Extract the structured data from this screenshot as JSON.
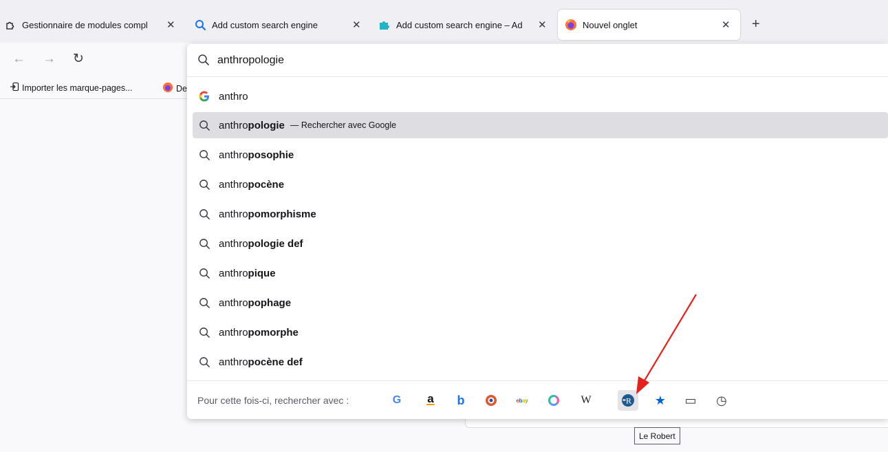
{
  "tabs": [
    {
      "title": "Gestionnaire de modules compl",
      "icon": "puzzle-outline-icon",
      "close": "✕"
    },
    {
      "title": "Add custom search engine",
      "icon": "search-icon",
      "close": "✕"
    },
    {
      "title": "Add custom search engine – Ad",
      "icon": "puzzle-blue-icon",
      "close": "✕"
    },
    {
      "title": "Nouvel onglet",
      "icon": "firefox-icon",
      "close": "✕",
      "active": true
    }
  ],
  "new_tab_label": "+",
  "nav": {
    "back": "←",
    "forward": "→",
    "reload": "↻"
  },
  "bookmarks": [
    {
      "label": "Importer les marque-pages...",
      "icon": "import-icon"
    },
    {
      "label": "De",
      "icon": "firefox-icon"
    }
  ],
  "urlbar": {
    "value": "anthropologie",
    "first_suggestion": {
      "text": "anthro",
      "icon": "google-icon"
    },
    "selected": {
      "typed": "anthro",
      "completion": "pologie",
      "action": "— Rechercher avec Google"
    },
    "suggestions": [
      {
        "typed": "anthro",
        "completion": "posophie"
      },
      {
        "typed": "anthro",
        "completion": "pocène"
      },
      {
        "typed": "anthro",
        "completion": "pomorphisme"
      },
      {
        "typed": "anthro",
        "completion": "pologie def"
      },
      {
        "typed": "anthro",
        "completion": "pique"
      },
      {
        "typed": "anthro",
        "completion": "pophage"
      },
      {
        "typed": "anthro",
        "completion": "pomorphe"
      },
      {
        "typed": "anthro",
        "completion": "pocène def"
      }
    ]
  },
  "oneoff": {
    "label": "Pour cette fois-ci, rechercher avec :",
    "engines": [
      {
        "name": "google-engine-icon",
        "glyph": "G",
        "color": "#4285f4"
      },
      {
        "name": "amazon-engine-icon",
        "glyph": "a",
        "color": "#111111"
      },
      {
        "name": "bing-engine-icon",
        "glyph": "b",
        "color": "#1a73e8"
      },
      {
        "name": "duckduckgo-engine-icon",
        "glyph": "●",
        "color": "#de5833"
      },
      {
        "name": "ebay-engine-icon",
        "glyph": "ebay",
        "color": "#e53238"
      },
      {
        "name": "qwant-engine-icon",
        "glyph": "Q",
        "color": "#5c97ff"
      },
      {
        "name": "wikipedia-engine-icon",
        "glyph": "W",
        "color": "#222222"
      },
      {
        "name": "le-robert-engine-icon",
        "glyph": "R",
        "color": "#1f5a8c"
      },
      {
        "name": "bookmarks-star-icon",
        "glyph": "★",
        "color": "#0060df"
      },
      {
        "name": "tabs-icon",
        "glyph": "▭",
        "color": "#3a3944"
      },
      {
        "name": "history-clock-icon",
        "glyph": "◷",
        "color": "#3a3944"
      }
    ]
  },
  "tooltip": "Le Robert",
  "colors": {
    "arrow": "#e8201d",
    "selected_row": "#dddde2",
    "accent": "#0060df"
  }
}
